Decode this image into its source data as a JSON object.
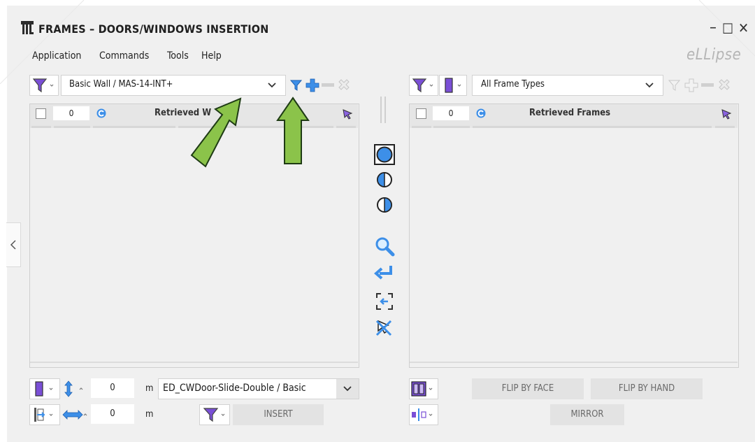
{
  "window": {
    "title": "FRAMES – DOORS/WINDOWS INSERTION",
    "controls": {
      "minimize": "–",
      "maximize": "☐",
      "close": "✕"
    }
  },
  "menu": [
    "Application",
    "Commands",
    "Tools",
    "Help"
  ],
  "brand": "eLLipse",
  "left_panel": {
    "wall_type": "Basic Wall / MAS-14-INT+",
    "count": "0",
    "header": "Retrieved W",
    "bottom": {
      "offset_value": "0",
      "offset_unit": "m",
      "family": "ED_CWDoor-Slide-Double / Basic",
      "spacing_value": "0",
      "spacing_unit": "m",
      "insert_label": "INSERT"
    }
  },
  "right_panel": {
    "frame_type": "All Frame Types",
    "count": "0",
    "header": "Retrieved Frames",
    "buttons": {
      "flip_face": "FLIP BY FACE",
      "flip_hand": "FLIP BY HAND",
      "mirror": "MIRROR"
    }
  },
  "colors": {
    "accent_blue": "#3d8fe8",
    "filter_purple": "#7a4fd6",
    "arrow_green": "#8bc34a",
    "arrow_outline": "#1e3b14"
  },
  "icons": [
    "app-logo-icon",
    "filter-icon",
    "filter-add-icon",
    "plus-icon",
    "minus-icon",
    "clear-icon",
    "refresh-icon",
    "select-cursor-icon",
    "circle-full-icon",
    "circle-half-left-icon",
    "circle-half-right-icon",
    "zoom-icon",
    "return-icon",
    "fit-view-icon",
    "remove-selection-icon",
    "collapse-chevron-icon"
  ]
}
